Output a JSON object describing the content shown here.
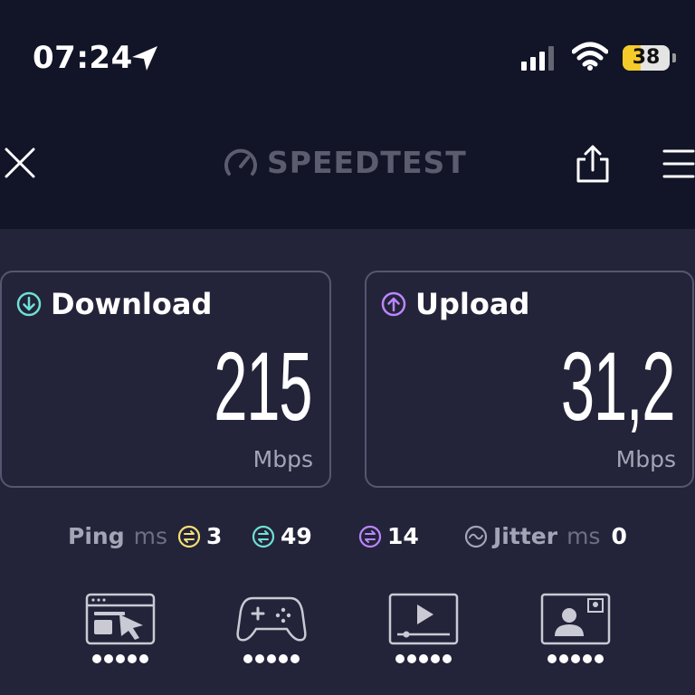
{
  "status_bar": {
    "time": "07:24",
    "battery": "38",
    "battery_level": 0.38,
    "icons": [
      "location-arrow-icon",
      "cellular-signal-icon",
      "wifi-icon",
      "battery-icon"
    ]
  },
  "header": {
    "logo_text": "SPEEDTEST",
    "icons": [
      "close-icon",
      "speedometer-icon",
      "share-icon",
      "menu-icon"
    ]
  },
  "download": {
    "label": "Download",
    "value": "215",
    "unit": "Mbps",
    "accent": "#6fe0d6",
    "icon": "download-arrow-icon"
  },
  "upload": {
    "label": "Upload",
    "value": "31,2",
    "unit": "Mbps",
    "accent": "#bc86ff",
    "icon": "upload-arrow-icon"
  },
  "ping": {
    "label": "Ping",
    "unit": "ms",
    "idle": "3",
    "download": "49",
    "upload": "14",
    "colors": {
      "idle": "#f5e078",
      "download": "#6fe0d6",
      "upload": "#bc86ff"
    }
  },
  "jitter": {
    "label": "Jitter",
    "unit": "ms",
    "value": "0",
    "icon": "wave-icon"
  },
  "experience": {
    "icons": [
      "web-browsing-icon",
      "gaming-icon",
      "video-streaming-icon",
      "video-call-icon"
    ],
    "dots": 5
  },
  "colors": {
    "header_bg": "#121427",
    "body_bg": "#232439",
    "card_border": "#555771"
  }
}
